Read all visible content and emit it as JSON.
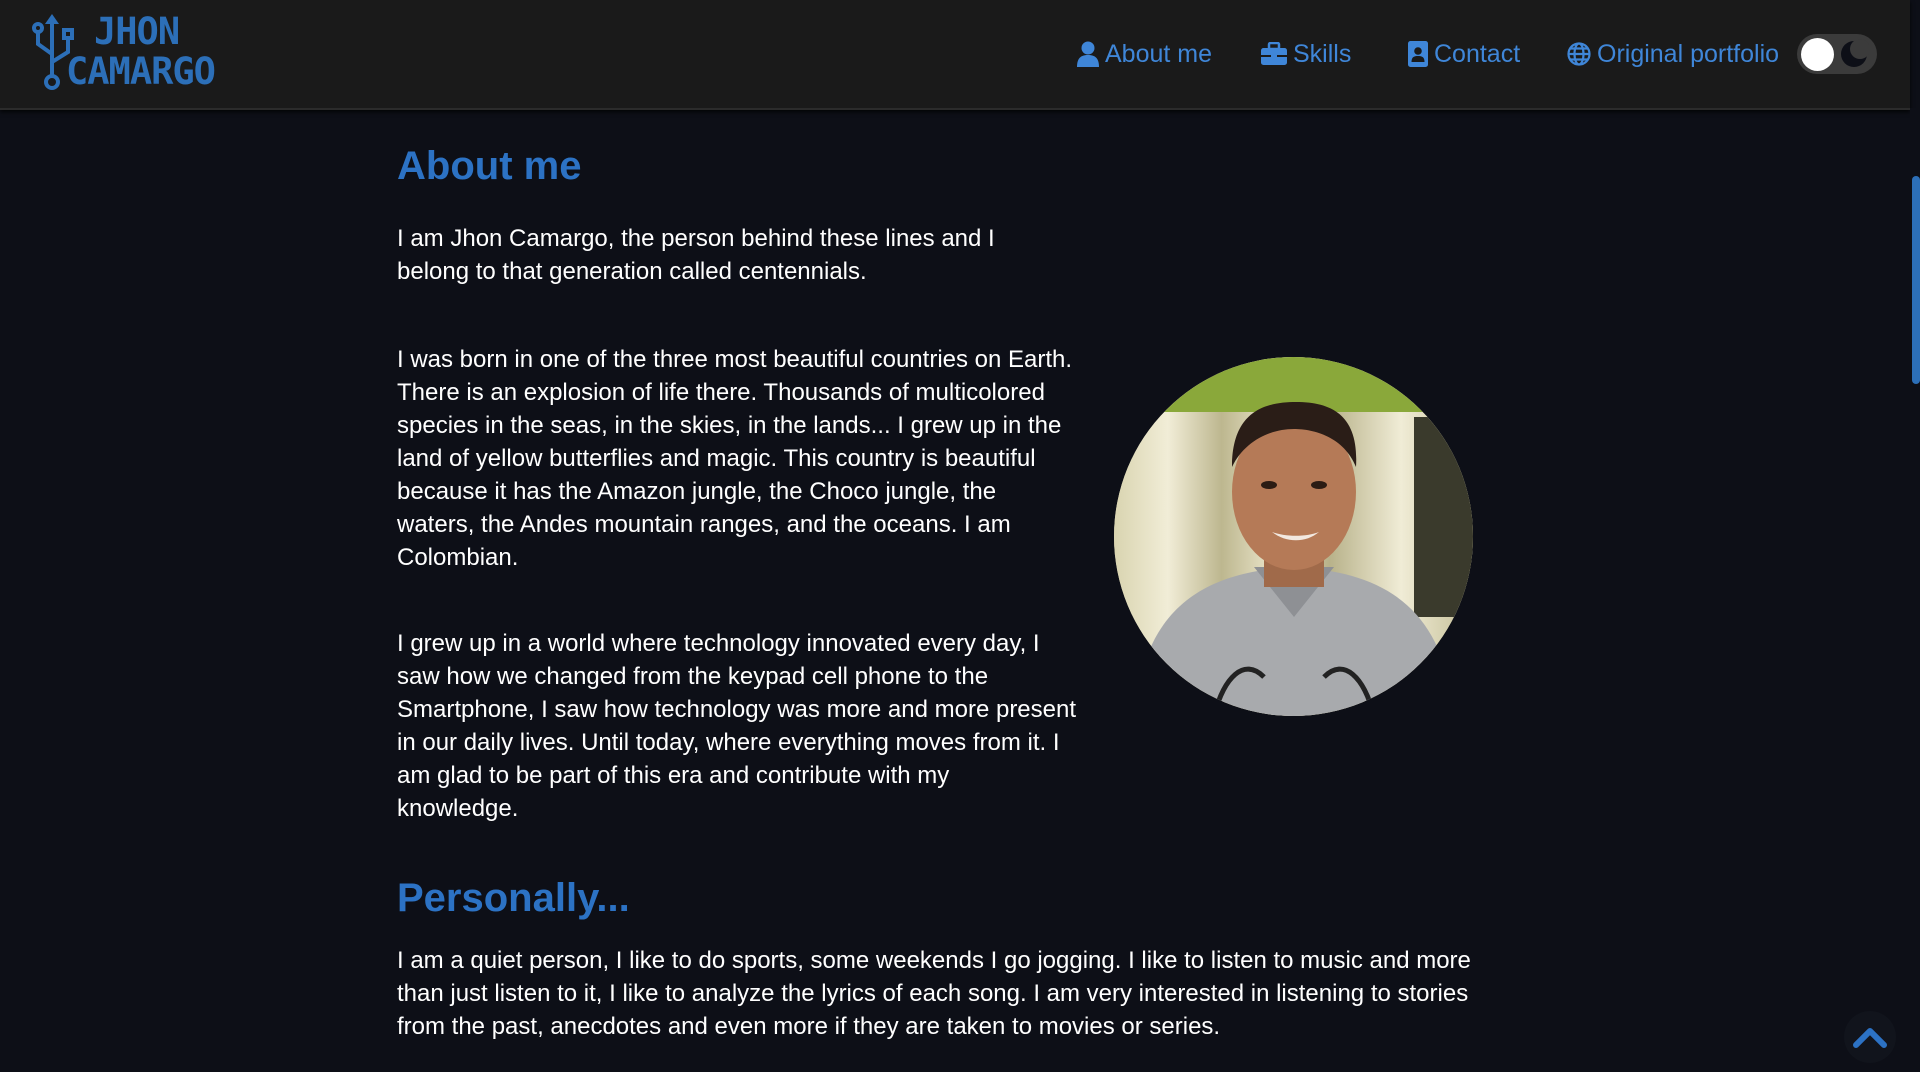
{
  "header": {
    "logo": {
      "line1": "JHON",
      "line2": "CAMARGO"
    },
    "nav": [
      {
        "label": "About me",
        "icon": "user-icon"
      },
      {
        "label": "Skills",
        "icon": "briefcase-icon"
      },
      {
        "label": "Contact",
        "icon": "contact-card-icon"
      },
      {
        "label": "Original portfolio",
        "icon": "globe-icon"
      }
    ],
    "theme_toggle": {
      "icon": "moon-icon",
      "state": "dark"
    }
  },
  "about": {
    "title": "About me",
    "paragraphs": [
      "I am Jhon Camargo, the person behind these lines and I belong to that generation called centennials.",
      "I was born in one of the three most beautiful countries on Earth. There is an explosion of life there. Thousands of multicolored species in the seas, in the skies, in the lands... I grew up in the land of yellow butterflies and magic. This country is beautiful because it has the Amazon jungle, the Choco jungle, the waters, the Andes mountain ranges, and the oceans. I am Colombian.",
      "I grew up in a world where technology innovated every day, I saw how we changed from the keypad cell phone to the Smartphone, I saw how technology was more and more present in our daily lives. Until today, where everything moves from it. I am glad to be part of this era and contribute with my knowledge."
    ]
  },
  "personally": {
    "title": "Personally...",
    "paragraph": "I am a quiet person, I like to do sports, some weekends I go jogging. I like to listen to music and more than just listen to it, I like to analyze the lyrics of each song. I am very interested in listening to stories from the past, anecdotes and even more if they are taken to movies or series."
  },
  "colors": {
    "accent": "#2c72c4",
    "background": "#0d0f17",
    "navbar": "#1a1a1a"
  },
  "scroll_top_icon": "chevron-up-icon"
}
